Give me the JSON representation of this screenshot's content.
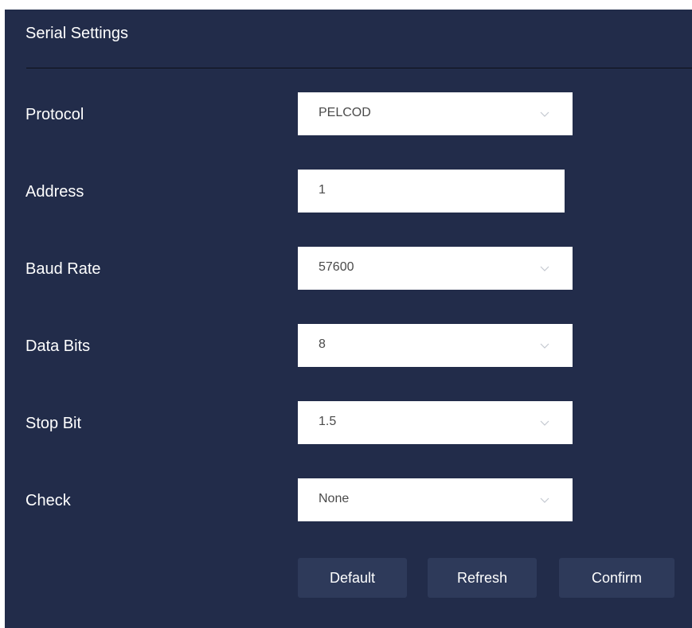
{
  "panel": {
    "title": "Serial Settings"
  },
  "fields": {
    "protocol": {
      "label": "Protocol",
      "value": "PELCOD",
      "type": "select"
    },
    "address": {
      "label": "Address",
      "value": "1",
      "type": "text"
    },
    "baud_rate": {
      "label": "Baud Rate",
      "value": "57600",
      "type": "select"
    },
    "data_bits": {
      "label": "Data Bits",
      "value": "8",
      "type": "select"
    },
    "stop_bit": {
      "label": "Stop Bit",
      "value": "1.5",
      "type": "select"
    },
    "check": {
      "label": "Check",
      "value": "None",
      "type": "select"
    }
  },
  "buttons": {
    "default": "Default",
    "refresh": "Refresh",
    "confirm": "Confirm"
  },
  "icons": {
    "select_arrow": "chevron-down-icon"
  },
  "colors": {
    "panel_background": "#222c4a",
    "button_background": "#2e3a5a",
    "text": "#ffffff",
    "field_background": "#ffffff",
    "field_text": "#4a4a4a"
  }
}
